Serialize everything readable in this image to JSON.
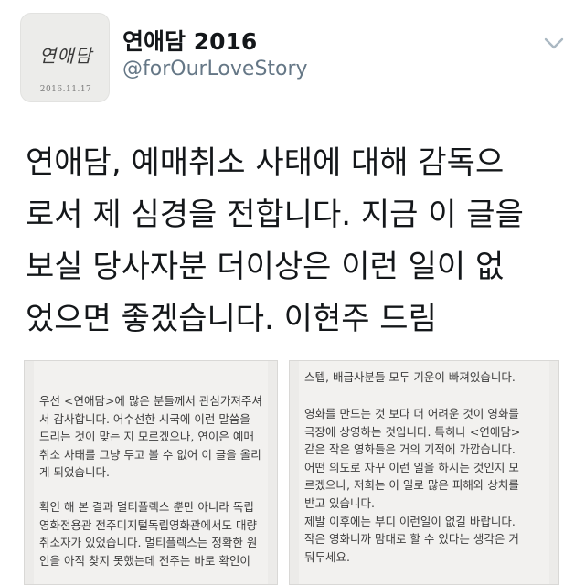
{
  "profile": {
    "avatar_script": "연애담",
    "avatar_date": "2016.11.17",
    "display_name": "연애담 2016",
    "handle": "@forOurLoveStory",
    "menu_icon": "chevron-down-icon"
  },
  "tweet": {
    "lines": [
      "연애담, 예매취소 사태에 대해 감독으",
      "로서 제 심경을 전합니다. 지금 이 글을",
      "보실 당사자분 더이상은 이런 일이 없",
      "었으면 좋겠습니다. 이현주 드림"
    ]
  },
  "attachments": {
    "left": {
      "paragraph1": [
        "우선 <연애담>에 많은 분들께서 관심가져주셔",
        "서 감사합니다. 어수선한 시국에 이런 말씀을",
        "드리는 것이 맞는 지 모르겠으나, 연이은 예매",
        "취소 사태를 그냥 두고 볼 수 없어 이 글을 올리",
        "게 되었습니다."
      ],
      "paragraph2": [
        "확인 해 본 결과 멀티플렉스 뿐만 아니라 독립",
        "영화전용관 전주디지털독립영화관에서도 대량",
        "취소자가 있었습니다. 멀티플렉스는 정확한 원",
        "인을 아직 찾지 못했는데 전주는 바로 확인이"
      ]
    },
    "right": {
      "paragraph1": [
        "스텝, 배급사분들 모두 기운이 빠져있습니다."
      ],
      "paragraph2": [
        "영화를 만드는 것 보다 더 어려운 것이 영화를",
        "극장에 상영하는 것입니다. 특히나 <연애담>",
        "같은 작은 영화들은 거의 기적에 가깝습니다.",
        "어떤 의도로 자꾸 이런 일을 하시는 것인지 모",
        "르겠으나, 저희는 이 일로 많은 피해와 상처를",
        "받고 있습니다.",
        "제발 이후에는 부디 이런일이 없길 바랍니다.",
        "작은 영화니까 맘대로 할 수 있다는 생각은 거",
        "둬두세요."
      ]
    }
  },
  "colors": {
    "text_primary": "#14171a",
    "text_secondary": "#657786",
    "photo_background": "#ecebe9",
    "photo_text": "#3c3c3c"
  }
}
